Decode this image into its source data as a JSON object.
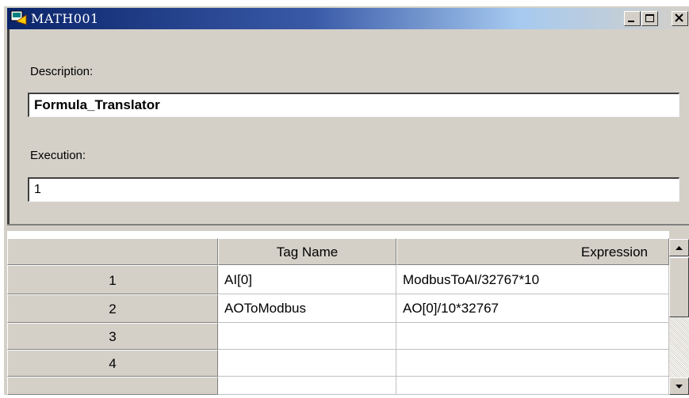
{
  "window": {
    "title": "MATH001"
  },
  "controls": {
    "minimize": "_",
    "maximize": "□",
    "close": "×"
  },
  "form": {
    "description_label": "Description:",
    "description_value": "Formula_Translator",
    "execution_label": "Execution:",
    "execution_value": "1"
  },
  "grid": {
    "columns": [
      "",
      "Tag Name",
      "Expression"
    ],
    "rows": [
      {
        "num": "1",
        "tag": "AI[0]",
        "expr": "ModbusToAI/32767*10"
      },
      {
        "num": "2",
        "tag": "AOToModbus",
        "expr": "AO[0]/10*32767"
      },
      {
        "num": "3",
        "tag": "",
        "expr": ""
      },
      {
        "num": "4",
        "tag": "",
        "expr": ""
      }
    ]
  },
  "icons": [
    "app-icon",
    "minimize-icon",
    "maximize-icon",
    "close-icon",
    "scroll-up-icon",
    "scroll-down-icon"
  ]
}
